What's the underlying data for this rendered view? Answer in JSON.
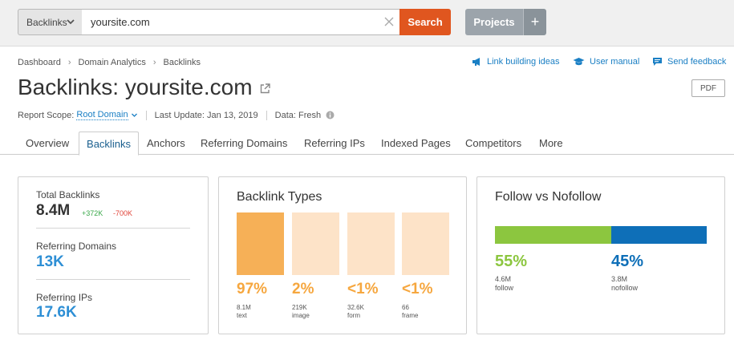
{
  "search": {
    "database": "Backlinks",
    "query": "yoursite.com",
    "button": "Search"
  },
  "header_buttons": {
    "projects": "Projects",
    "add": "+"
  },
  "breadcrumb": [
    "Dashboard",
    "Domain Analytics",
    "Backlinks"
  ],
  "helper_links": {
    "link_building": "Link building ideas",
    "manual": "User manual",
    "feedback": "Send feedback"
  },
  "title": {
    "prefix": "Backlinks:",
    "domain": "yoursite.com"
  },
  "pdf_button": "PDF",
  "meta": {
    "scope_label": "Report Scope:",
    "scope_value": "Root Domain",
    "update": "Last Update: Jan 13, 2019",
    "data": "Data: Fresh"
  },
  "tabs": [
    "Overview",
    "Backlinks",
    "Anchors",
    "Referring Domains",
    "Referring IPs",
    "Indexed Pages",
    "Competitors",
    "More"
  ],
  "active_tab": "Backlinks",
  "summary": {
    "total_label": "Total Backlinks",
    "total_value": "8.4M",
    "delta_up": "+372K",
    "delta_down": "-700K",
    "domains_label": "Referring Domains",
    "domains_value": "13K",
    "ips_label": "Referring IPs",
    "ips_value": "17.6K"
  },
  "backlink_types": {
    "title": "Backlink Types",
    "items": [
      {
        "pct": "97%",
        "count": "8.1M",
        "type": "text"
      },
      {
        "pct": "2%",
        "count": "219K",
        "type": "image"
      },
      {
        "pct": "<1%",
        "count": "32.6K",
        "type": "form"
      },
      {
        "pct": "<1%",
        "count": "66",
        "type": "frame"
      }
    ]
  },
  "follow": {
    "title": "Follow vs Nofollow",
    "follow_share": 0.55,
    "follow_pct": "55%",
    "follow_count": "4.6M",
    "follow_label": "follow",
    "nofollow_pct": "45%",
    "nofollow_count": "3.8M",
    "nofollow_label": "nofollow"
  },
  "colors": {
    "accent_orange": "#e0561f",
    "link_blue": "#1a7fc4",
    "stat_blue": "#2e8fd5",
    "follow_green": "#8cc63f",
    "nofollow_blue": "#0e6fb8",
    "type_active": "#f6b057",
    "type_light": "#fde3c8",
    "delta_green": "#39a849",
    "delta_red": "#e0453a"
  },
  "icons": [
    "chevron-down-icon",
    "clear-icon",
    "megaphone-icon",
    "graduation-cap-icon",
    "chat-icon",
    "external-link-icon",
    "info-icon"
  ]
}
